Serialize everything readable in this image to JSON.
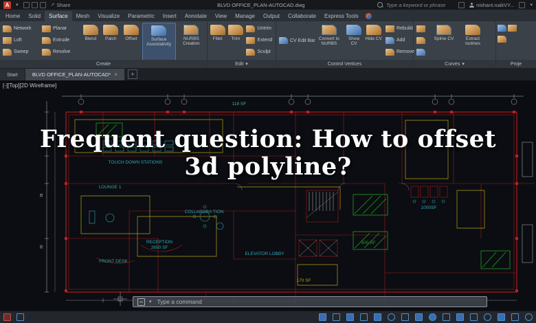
{
  "titlebar": {
    "logo": "A",
    "share": "Share",
    "doc_title": "BLVD OFFICE_PLAN-AUTOCAD.dwg",
    "search_placeholder": "Type a keyword or phrase",
    "username": "nishant.naikVY..."
  },
  "icons": {
    "dropdown": "▾",
    "close": "×",
    "plus": "+",
    "share_arrow": "↗",
    "minus": "–"
  },
  "ribbon_tabs": [
    {
      "label": "Home"
    },
    {
      "label": "Solid"
    },
    {
      "label": "Surface",
      "active": true
    },
    {
      "label": "Mesh"
    },
    {
      "label": "Visualize"
    },
    {
      "label": "Parametric"
    },
    {
      "label": "Insert"
    },
    {
      "label": "Annotate"
    },
    {
      "label": "View"
    },
    {
      "label": "Manage"
    },
    {
      "label": "Output"
    },
    {
      "label": "Collaborate"
    },
    {
      "label": "Express Tools"
    }
  ],
  "panels": {
    "create": {
      "title": "Create",
      "network": "Network",
      "planar": "Planar",
      "loft": "Loft",
      "extrude": "Extrude",
      "sweep": "Sweep",
      "revolve": "Revolve",
      "blend": "Blend",
      "patch": "Patch",
      "offset": "Offset",
      "surface_associativity": "Surface Associativity",
      "nurbs_creation": "NURBS Creation"
    },
    "edit": {
      "title": "Edit",
      "fillet": "Fillet",
      "trim": "Trim",
      "untrim": "Untrim",
      "extend": "Extend",
      "sculpt": "Sculpt"
    },
    "control_vertices": {
      "title": "Control Vertices",
      "cv_edit_bar": "CV Edit Bar",
      "convert_to_nurbs": "Convert to NURBS",
      "show_cv": "Show CV",
      "hide_cv": "Hide CV",
      "rebuild": "Rebuild",
      "add": "Add",
      "remove": "Remove"
    },
    "curves": {
      "title": "Curves",
      "spline_cv": "Spline CV",
      "extract_isolines": "Extract Isolines"
    },
    "projection": {
      "title": "Proje"
    }
  },
  "file_tabs": {
    "start": "Start",
    "active": "BLVD OFFICE_PLAN-AUTOCAD*"
  },
  "viewport_controls": "[-][Top][2D Wireframe]",
  "overlay": {
    "line1": "Frequent question: How to offset",
    "line2": "3d polyline?"
  },
  "plan_labels": {
    "area_118": "118 SF",
    "touch_down": "TOUCH DOWN STATIONS",
    "lounge": "LOUNGE 1",
    "collaboration": "COLLABORA TION",
    "reception": "RECEPTION",
    "reception_area": "2650 SF",
    "front_desk": "FRONT DESK",
    "elevator_lobby": "ELEVATOR LOBBY",
    "area_500": "500 SF",
    "area_1000": "1000SF",
    "area_170": "170 SF"
  },
  "dims": {
    "v1": "36",
    "v2": "30"
  },
  "command_bar": {
    "placeholder": "Type a command"
  },
  "colors": {
    "wall_red": "#c01f1f",
    "zone_yellow": "#b2a315",
    "label_cyan": "#2fa8b4",
    "hatch_green": "#23a023",
    "accent_blue": "#4b8fd6",
    "overlay_text": "#ffffff"
  }
}
